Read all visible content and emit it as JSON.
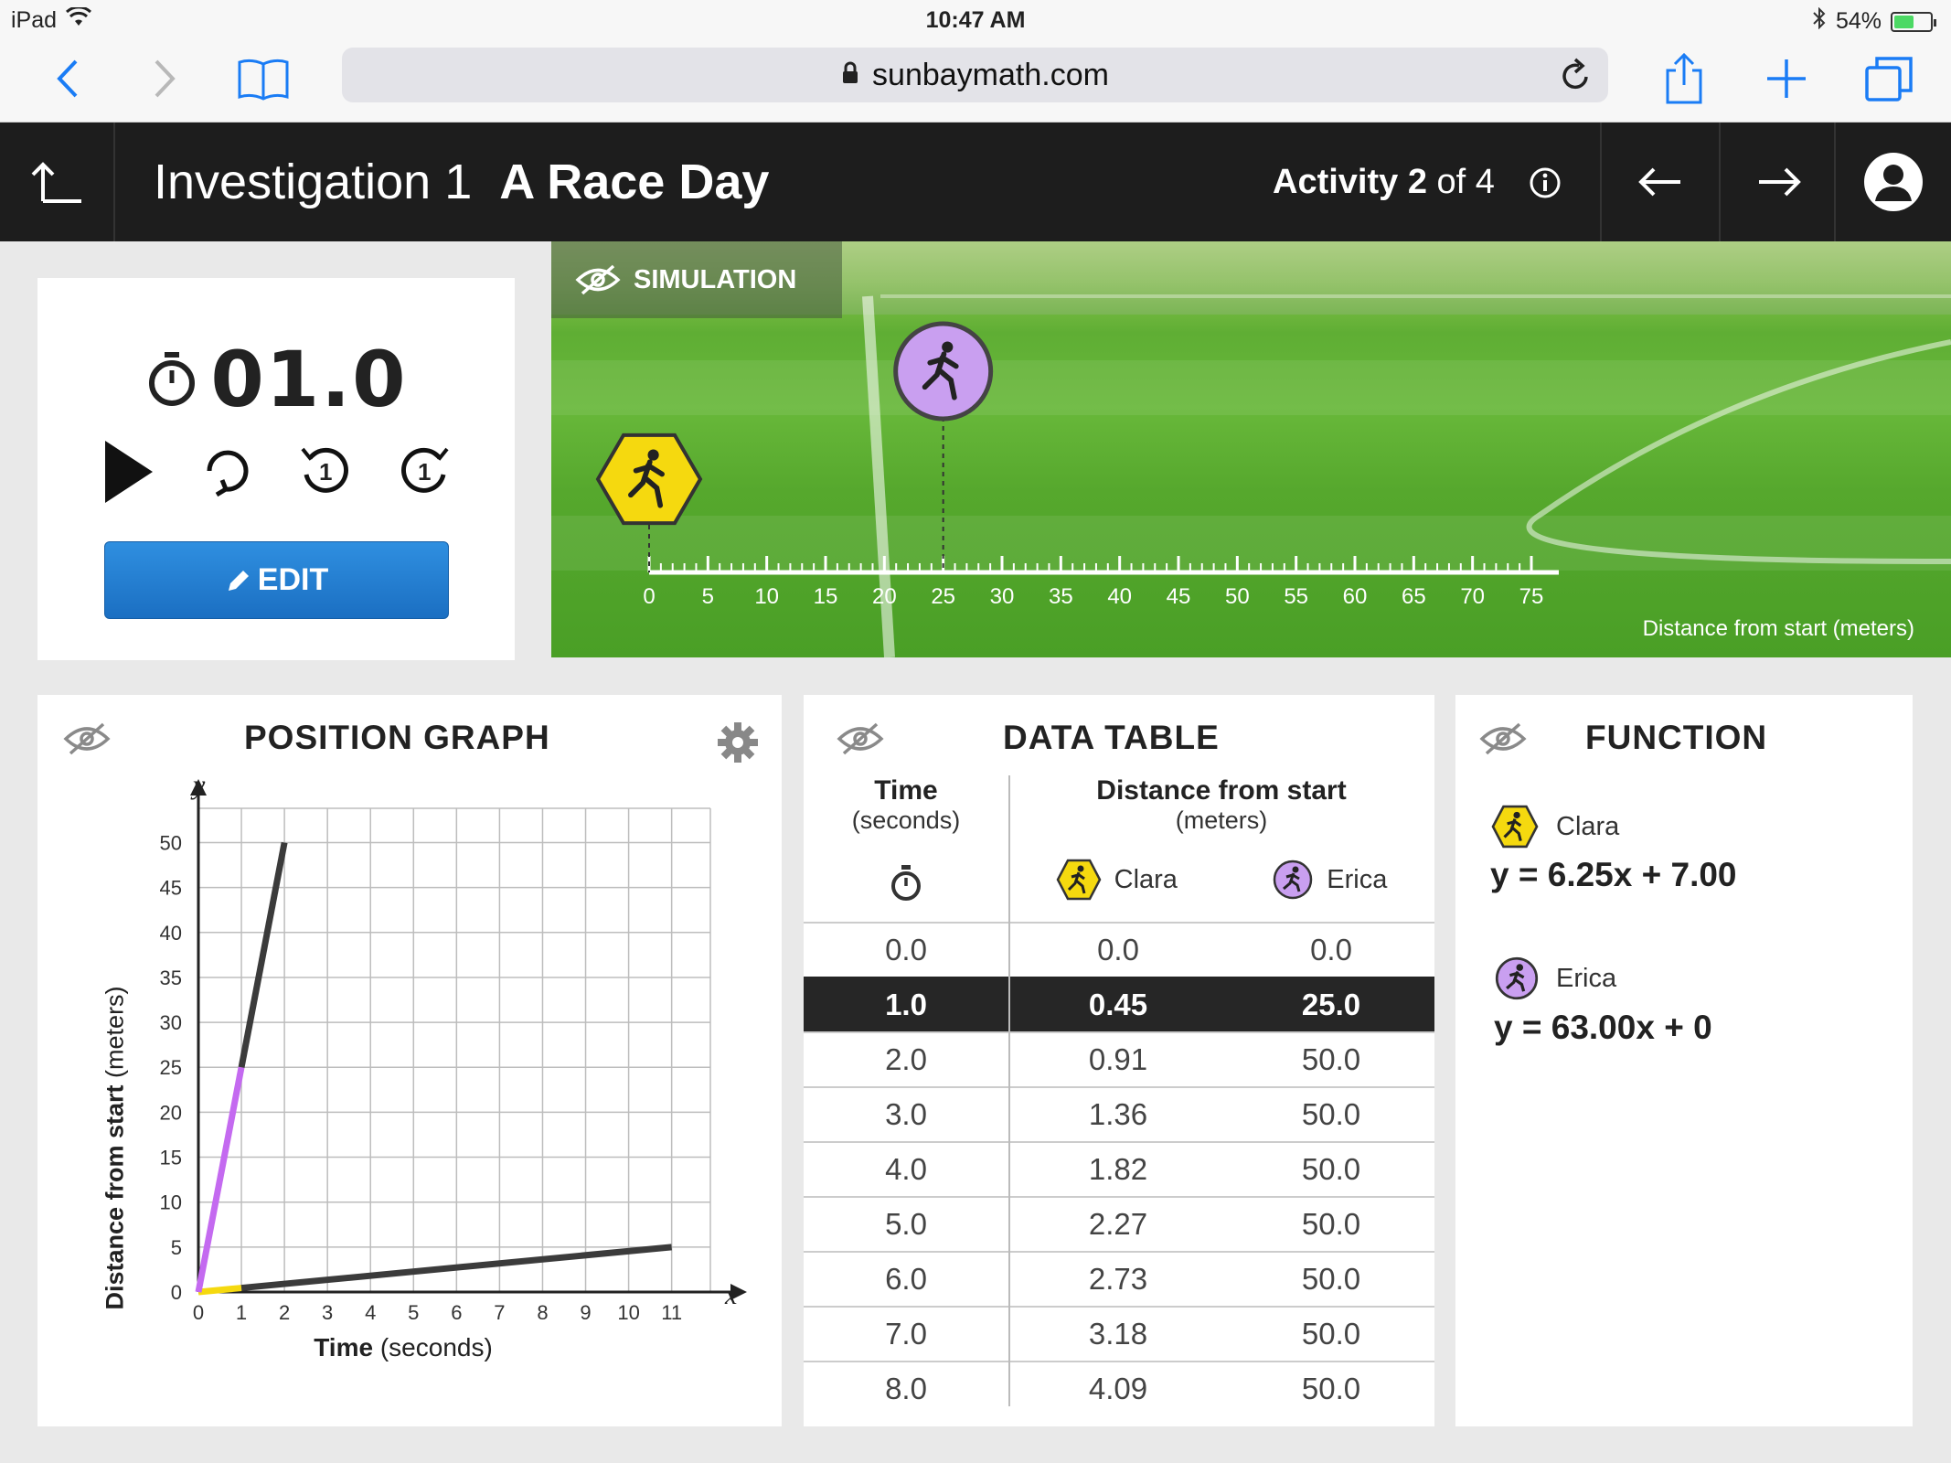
{
  "status_bar": {
    "device": "iPad",
    "time": "10:47 AM",
    "battery": "54%",
    "battery_level": 0.54
  },
  "browser": {
    "url": "sunbaymath.com"
  },
  "header": {
    "investigation": "Investigation 1",
    "title": "A Race Day",
    "activity_label": "Activity",
    "activity_num": "2",
    "activity_of": "of 4"
  },
  "timer": {
    "value": "01.0",
    "edit_label": "EDIT",
    "step_back_label": "1",
    "step_forward_label": "1"
  },
  "simulation": {
    "label": "SIMULATION",
    "axis_label": "Distance from start (meters)",
    "ticks": [
      "0",
      "5",
      "10",
      "15",
      "20",
      "25",
      "30",
      "35",
      "40",
      "45",
      "50",
      "55",
      "60",
      "65",
      "70",
      "75"
    ],
    "runners": [
      {
        "name": "Clara",
        "position_m": 0,
        "color": "#f5d90f",
        "shape": "hexagon"
      },
      {
        "name": "Erica",
        "position_m": 25,
        "color": "#c99ff0",
        "shape": "circle"
      }
    ]
  },
  "graph": {
    "title": "POSITION GRAPH",
    "y_var": "y",
    "x_var": "x",
    "ylabel_bold": "Distance from start",
    "ylabel_unit": "(meters)",
    "xlabel_bold": "Time",
    "xlabel_unit": "(seconds)"
  },
  "chart_data": {
    "type": "line",
    "xlim": [
      0,
      11.9
    ],
    "ylim": [
      0,
      53
    ],
    "x_ticks": [
      0,
      1,
      2,
      3,
      4,
      5,
      6,
      7,
      8,
      9,
      10,
      11
    ],
    "y_ticks": [
      0,
      5,
      10,
      15,
      20,
      25,
      30,
      35,
      40,
      45,
      50
    ],
    "grid": true,
    "series": [
      {
        "name": "Clara",
        "color": "#f5d90f",
        "future_color": "#3b3b3b",
        "points": [
          [
            0,
            0
          ],
          [
            1,
            0.45
          ],
          [
            11,
            5
          ]
        ]
      },
      {
        "name": "Erica",
        "color": "#c46af0",
        "future_color": "#3b3b3b",
        "points": [
          [
            0,
            0
          ],
          [
            1,
            25
          ],
          [
            2,
            50
          ]
        ]
      }
    ],
    "current_time": 1
  },
  "data_table": {
    "title": "DATA TABLE",
    "time_header": "Time",
    "time_unit": "(seconds)",
    "dist_header": "Distance from start",
    "dist_unit": "(meters)",
    "runner_cols": [
      "Clara",
      "Erica"
    ],
    "active_row": 1,
    "rows": [
      [
        "0.0",
        "0.0",
        "0.0"
      ],
      [
        "1.0",
        "0.45",
        "25.0"
      ],
      [
        "2.0",
        "0.91",
        "50.0"
      ],
      [
        "3.0",
        "1.36",
        "50.0"
      ],
      [
        "4.0",
        "1.82",
        "50.0"
      ],
      [
        "5.0",
        "2.27",
        "50.0"
      ],
      [
        "6.0",
        "2.73",
        "50.0"
      ],
      [
        "7.0",
        "3.18",
        "50.0"
      ],
      [
        "8.0",
        "4.09",
        "50.0"
      ]
    ]
  },
  "function": {
    "title": "FUNCTION",
    "entries": [
      {
        "name": "Clara",
        "equation": "y = 6.25x + 7.00"
      },
      {
        "name": "Erica",
        "equation": "y = 63.00x + 0"
      }
    ]
  }
}
